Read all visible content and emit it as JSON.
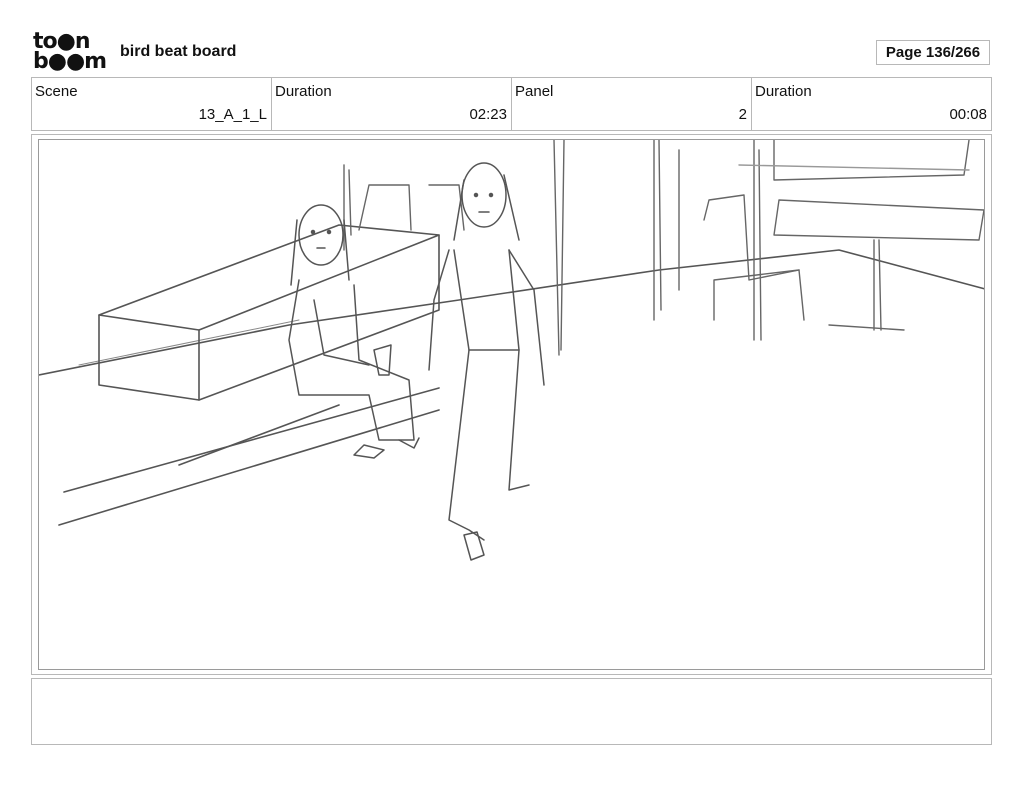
{
  "header": {
    "logo_row1": "to●n",
    "logo_row2": "b●●m",
    "project_title": "bird beat board",
    "page_indicator": "Page 136/266"
  },
  "info_table": {
    "scene_label": "Scene",
    "scene_value": "13_A_1_L",
    "scene_duration_label": "Duration",
    "scene_duration_value": "02:23",
    "panel_label": "Panel",
    "panel_value": "2",
    "panel_duration_label": "Duration",
    "panel_duration_value": "00:08"
  },
  "notes": {
    "text": ""
  },
  "colors": {
    "border": "#b8b8b8",
    "sketch": "#555555"
  }
}
